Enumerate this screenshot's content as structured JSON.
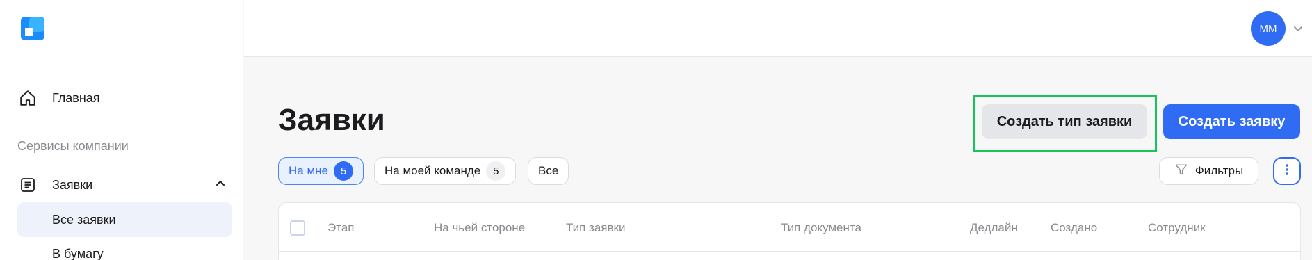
{
  "sidebar": {
    "home_label": "Главная",
    "section_label": "Сервисы компании",
    "requests_label": "Заявки",
    "sub_items": [
      "Все заявки",
      "В бумагу"
    ]
  },
  "topbar": {
    "avatar_initials": "ММ"
  },
  "main": {
    "title": "Заявки",
    "create_type_button": "Создать тип заявки",
    "create_request_button": "Создать заявку",
    "filter_chips": [
      {
        "label": "На мне",
        "count": "5",
        "active": true
      },
      {
        "label": "На моей команде",
        "count": "5",
        "active": false
      },
      {
        "label": "Все",
        "active": false
      }
    ],
    "filters_button": "Фильтры",
    "table": {
      "columns": [
        "Этап",
        "На чьей стороне",
        "Тип заявки",
        "Тип документа",
        "Дедлайн",
        "Создано",
        "Сотрудник"
      ]
    }
  },
  "colors": {
    "accent": "#2f6cf3",
    "highlight": "#17c35a",
    "active_bg": "#eef2fb"
  },
  "icons": [
    "logo-icon",
    "home-icon",
    "requests-icon",
    "chevron-up-icon",
    "chevron-down-icon",
    "filter-icon",
    "more-vertical-icon"
  ]
}
